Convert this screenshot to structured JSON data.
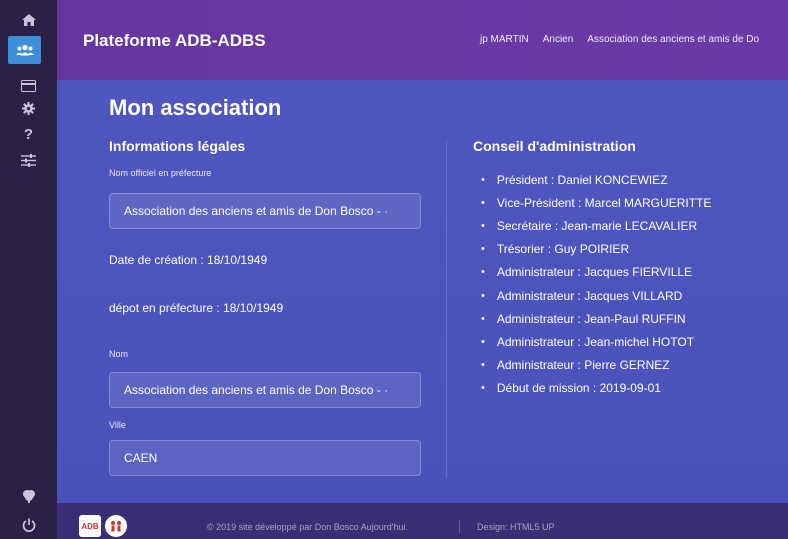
{
  "header": {
    "brand": "Plateforme ADB-ADBS",
    "links": [
      "jp MARTIN",
      "Ancien",
      "Association des anciens et amis de Do"
    ]
  },
  "sidebar": {
    "items": [
      {
        "icon": "home-icon"
      },
      {
        "icon": "users-icon",
        "active": true
      },
      {
        "icon": "card-icon"
      },
      {
        "icon": "gear-icon"
      },
      {
        "icon": "question-icon"
      },
      {
        "icon": "sliders-icon"
      }
    ],
    "bottom": [
      {
        "icon": "brain-icon"
      },
      {
        "icon": "power-icon"
      }
    ]
  },
  "main": {
    "title": "Mon association",
    "legal": {
      "title": "Informations légales",
      "official_name_label": "Nom officiel en préfecture",
      "official_name_value": "Association des anciens et amis de Don Bosco - ·",
      "creation_date": "Date de création : 18/10/1949",
      "prefecture_date": "dépot en préfecture : 18/10/1949",
      "name_label": "Nom",
      "name_value": "Association des anciens et amis de Don Bosco - ·",
      "city_label": "Ville",
      "city_value": "CAEN"
    },
    "board": {
      "title": "Conseil d'administration",
      "members": [
        "Président : Daniel KONCEWIEZ",
        "Vice-Président : Marcel MARGUERITTE",
        "Secrétaire : Jean-marie LECAVALIER",
        "Trésorier : Guy POIRIER",
        "Administrateur : Jacques FIERVILLE",
        "Administrateur : Jacques VILLARD",
        "Administrateur : Jean-Paul RUFFIN",
        "Administrateur : Jean-michel HOTOT",
        "Administrateur : Pierre GERNEZ",
        "Début de mission : 2019-09-01"
      ]
    }
  },
  "footer": {
    "logo1": "ADB",
    "credit": "© 2019 site développé par Don Bosco Aujourd'hui.",
    "design": "Design: HTML5 UP"
  },
  "colors": {
    "sidebar": "#2b2147",
    "accent": "#3d8fd9",
    "header": "#6636a0",
    "main": "#4f56bf",
    "footer": "#3a2f75"
  }
}
